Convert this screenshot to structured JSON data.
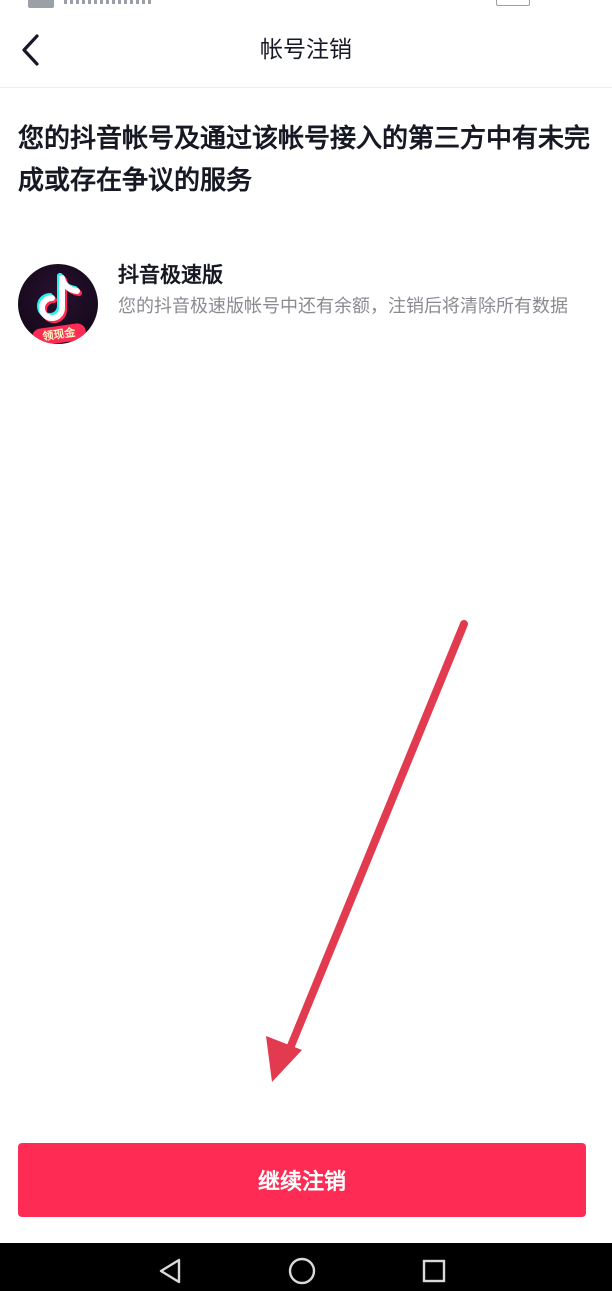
{
  "header": {
    "title": "帐号注销",
    "back_icon": "chevron-left-icon"
  },
  "notice": {
    "text": "您的抖音帐号及通过该帐号接入的第三方中有未完成或存在争议的服务"
  },
  "services": [
    {
      "name": "抖音极速版",
      "badge": "领现金",
      "description": "您的抖音极速版帐号中还有余额，注销后将清除所有数据",
      "icon": "tiktok-lite-app-icon"
    }
  ],
  "actions": {
    "continue_label": "继续注销"
  },
  "colors": {
    "accent": "#fe2c55",
    "annotation_arrow": "#e23a4e",
    "text_primary": "#161823",
    "text_secondary": "#8a8b91"
  },
  "nav_bar": {
    "back_icon": "triangle-back-icon",
    "home_icon": "circle-home-icon",
    "recents_icon": "square-recents-icon"
  }
}
